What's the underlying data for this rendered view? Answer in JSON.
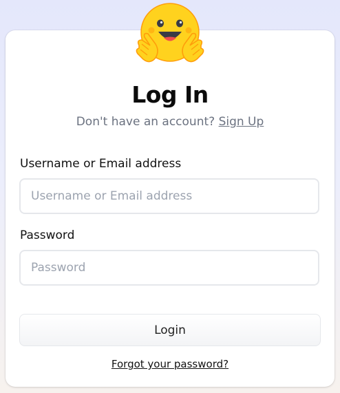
{
  "logo": {
    "icon": "hugging-face-emoji-icon",
    "colors": {
      "face": "#FFD21E",
      "face_outline": "#FF9D0B",
      "eyes": "#3A3B45",
      "mouth": "#3A3B45",
      "tongue": "#EF4E4E"
    }
  },
  "header": {
    "title": "Log In",
    "prompt": "Don't have an account?",
    "signup_link": "Sign Up"
  },
  "form": {
    "username": {
      "label": "Username or Email address",
      "placeholder": "Username or Email address",
      "value": ""
    },
    "password": {
      "label": "Password",
      "placeholder": "Password",
      "value": ""
    },
    "submit_label": "Login",
    "forgot_link": "Forgot your password?"
  },
  "colors": {
    "background_top": "#e4e7fb",
    "background_bottom": "#f7f2ee",
    "card": "#ffffff",
    "muted_text": "#6b7280",
    "input_border": "#e5e7eb"
  }
}
